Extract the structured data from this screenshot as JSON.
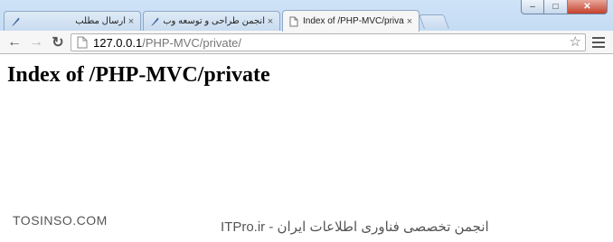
{
  "window": {
    "minimize_label": "–",
    "maximize_label": "□",
    "close_label": "✕"
  },
  "tabs": [
    {
      "title": "ارسال مطلب",
      "close": "×",
      "rtl": true,
      "active": false
    },
    {
      "title": "انجمن طراحی و توسعه وب",
      "close": "×",
      "rtl": true,
      "active": false
    },
    {
      "title": "Index of /PHP-MVC/private",
      "close": "×",
      "rtl": false,
      "active": true
    }
  ],
  "toolbar": {
    "back_icon": "←",
    "forward_icon": "→",
    "reload_icon": "↻",
    "url_host": "127.0.0.1",
    "url_path": "/PHP-MVC/private/",
    "star_icon": "☆"
  },
  "page": {
    "heading": "Index of /PHP-MVC/private"
  },
  "watermark": {
    "left": "TOSINSO.COM",
    "right": "ITPro.ir - انجمن تخصصی فناوری اطلاعات ایران"
  },
  "colors": {
    "chrome_bg": "#cfe3f7",
    "toolbar_bg": "#f6f6f6",
    "close_button": "#c4402c"
  }
}
